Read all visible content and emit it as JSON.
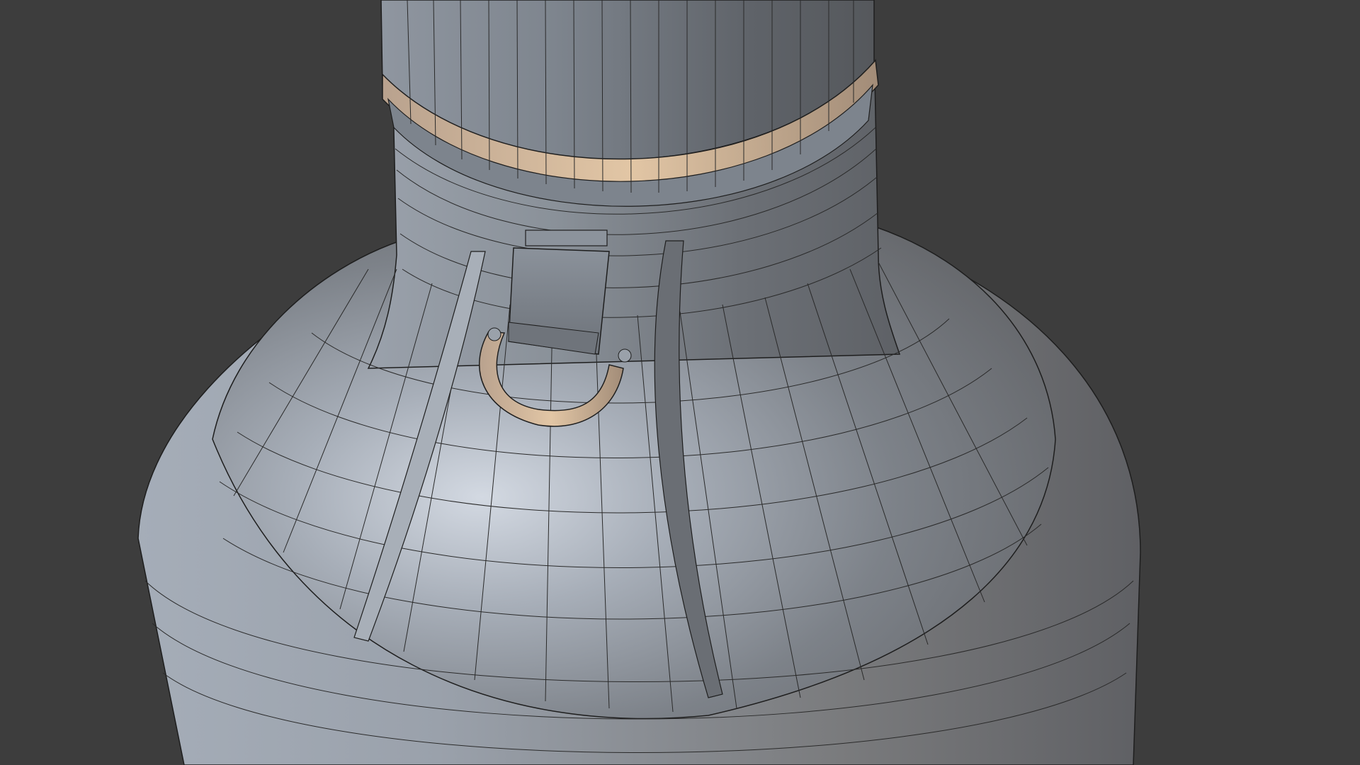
{
  "viewport": {
    "background_color": "#3d3d3d",
    "wireframe_color": "#1a1a1a",
    "model_base_color": "#8e959e",
    "highlight_color": "#cfd6e0",
    "accent_edge_color": "#e0a77d"
  }
}
